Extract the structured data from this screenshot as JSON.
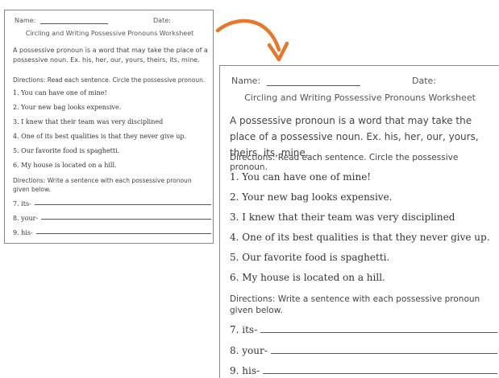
{
  "worksheet": {
    "name_label": "Name:",
    "date_label": "Date:",
    "title": "Circling and Writing Possessive Pronouns Worksheet",
    "intro": "A possessive pronoun is a word that may take the place of a possessive noun. Ex. his, her, our, yours, theirs, its, mine.",
    "directions1": "Directions: Read each sentence. Circle the possessive pronoun.",
    "sentences": [
      "1. You can have one of mine!",
      "2. Your new bag looks expensive.",
      "3. I knew that their team was very disciplined",
      "4. One of its best qualities is that they never give up.",
      "5. Our favorite food is spaghetti.",
      "6. My house is located on a hill."
    ],
    "directions2": "Directions: Write a sentence with each possessive pronoun given below.",
    "write_items": [
      "7. its-",
      "8. your-",
      "9. his-"
    ]
  },
  "colors": {
    "arrow": "#e8772e"
  }
}
